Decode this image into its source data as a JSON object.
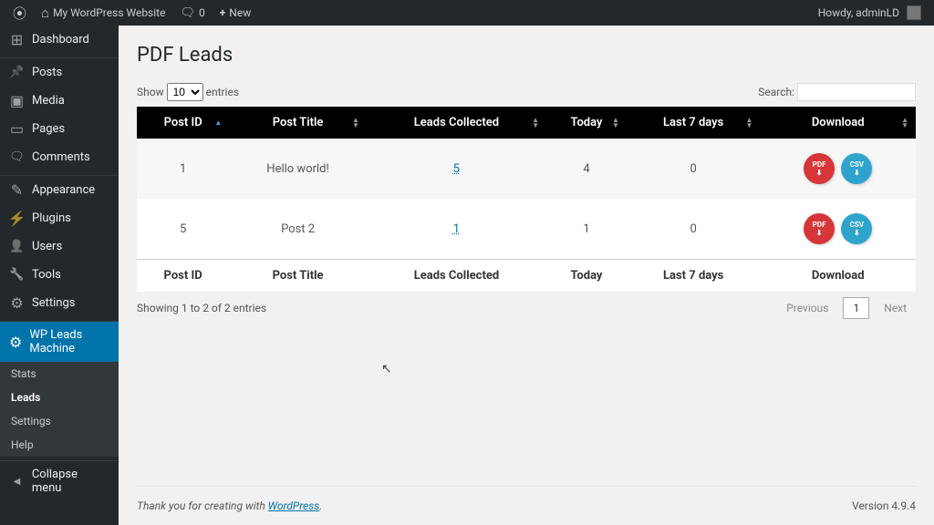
{
  "adminBar": {
    "siteName": "My WordPress Website",
    "commentsCount": "0",
    "newLabel": "New",
    "howdy": "Howdy, adminLD"
  },
  "sidebar": {
    "dashboard": "Dashboard",
    "posts": "Posts",
    "media": "Media",
    "pages": "Pages",
    "comments": "Comments",
    "appearance": "Appearance",
    "plugins": "Plugins",
    "users": "Users",
    "tools": "Tools",
    "settings": "Settings",
    "wpLeadsMachine": "WP Leads Machine",
    "sub": {
      "stats": "Stats",
      "leads": "Leads",
      "settings": "Settings",
      "help": "Help"
    },
    "collapse": "Collapse menu"
  },
  "page": {
    "title": "PDF Leads"
  },
  "datatable": {
    "showLabel": "Show",
    "entriesLabel": "entries",
    "perPage": "10",
    "searchLabel": "Search:",
    "columns": {
      "postId": "Post ID",
      "postTitle": "Post Title",
      "leadsCollected": "Leads Collected",
      "today": "Today",
      "last7": "Last 7 days",
      "download": "Download"
    },
    "rows": [
      {
        "postId": "1",
        "postTitle": "Hello world!",
        "leads": "5",
        "today": "4",
        "last7": "0"
      },
      {
        "postId": "5",
        "postTitle": "Post 2",
        "leads": "1",
        "today": "1",
        "last7": "0"
      }
    ],
    "info": "Showing 1 to 2 of 2 entries",
    "prev": "Previous",
    "page1": "1",
    "next": "Next",
    "pdfLabel": "PDF",
    "csvLabel": "CSV"
  },
  "footer": {
    "thanks": "Thank you for creating with ",
    "wp": "WordPress",
    "period": ".",
    "version": "Version 4.9.4"
  }
}
